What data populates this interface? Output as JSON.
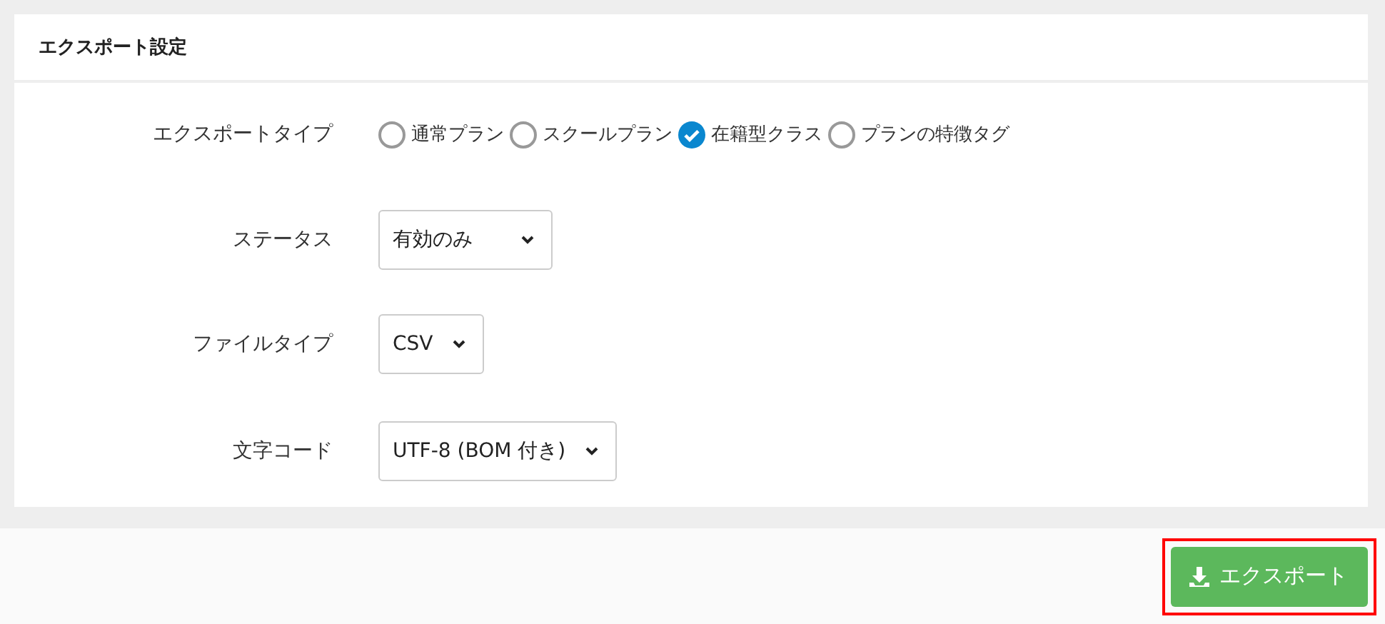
{
  "panel": {
    "title": "エクスポート設定"
  },
  "fields": [
    {
      "kind": "radio",
      "label": "エクスポートタイプ",
      "options": [
        {
          "label": "通常プラン",
          "selected": false
        },
        {
          "label": "スクールプラン",
          "selected": false
        },
        {
          "label": "在籍型クラス",
          "selected": true
        },
        {
          "label": "プランの特徴タグ",
          "selected": false
        }
      ]
    },
    {
      "kind": "select",
      "label": "ステータス",
      "value": "有効のみ"
    },
    {
      "kind": "select",
      "label": "ファイルタイプ",
      "value": "CSV"
    },
    {
      "kind": "select",
      "label": "文字コード",
      "value": "UTF-8 (BOM 付き)"
    }
  ],
  "export_button": {
    "label": "エクスポート",
    "highlighted": true
  }
}
